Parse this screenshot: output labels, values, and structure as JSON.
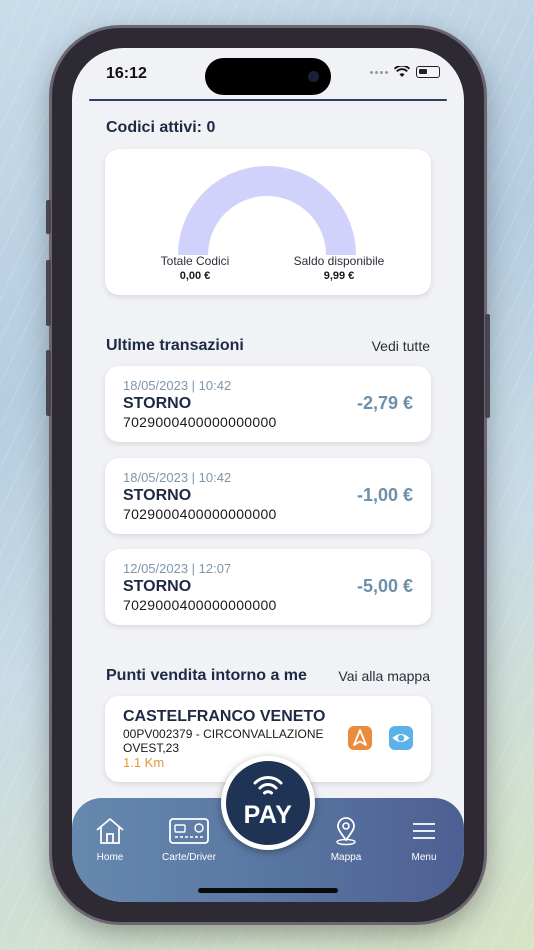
{
  "status_bar": {
    "time": "16:12"
  },
  "active_codes": {
    "title": "Codici attivi: 0",
    "total_label": "Totale Codici",
    "total_value": "0,00 €",
    "balance_label": "Saldo disponibile",
    "balance_value": "9,99 €",
    "gauge_color": "#d1d2fb"
  },
  "transactions": {
    "title": "Ultime transazioni",
    "see_all": "Vedi tutte",
    "items": [
      {
        "date": "18/05/2023 | 10:42",
        "type": "STORNO",
        "code": "7029000400000000000",
        "amount": "-2,79 €"
      },
      {
        "date": "18/05/2023 | 10:42",
        "type": "STORNO",
        "code": "7029000400000000000",
        "amount": "-1,00 €"
      },
      {
        "date": "12/05/2023 | 12:07",
        "type": "STORNO",
        "code": "7029000400000000000",
        "amount": "-5,00 €"
      }
    ]
  },
  "nearby": {
    "title": "Punti vendita intorno a me",
    "map_link": "Vai alla mappa",
    "store": {
      "name": "CASTELFRANCO VENETO",
      "address": "00PV002379 - CIRCONVALLAZIONE OVEST,23",
      "distance": "1.1 Km"
    }
  },
  "tabbar": {
    "home": "Home",
    "cards": "Carte/Driver",
    "pay": "PAY",
    "map": "Mappa",
    "menu": "Menu"
  },
  "colors": {
    "accent_dark": "#1e2a44",
    "amount": "#6e8fa9",
    "distance": "#e6973b",
    "nav_icon": "#ea8c3c",
    "eye_icon": "#5cb1e6"
  }
}
